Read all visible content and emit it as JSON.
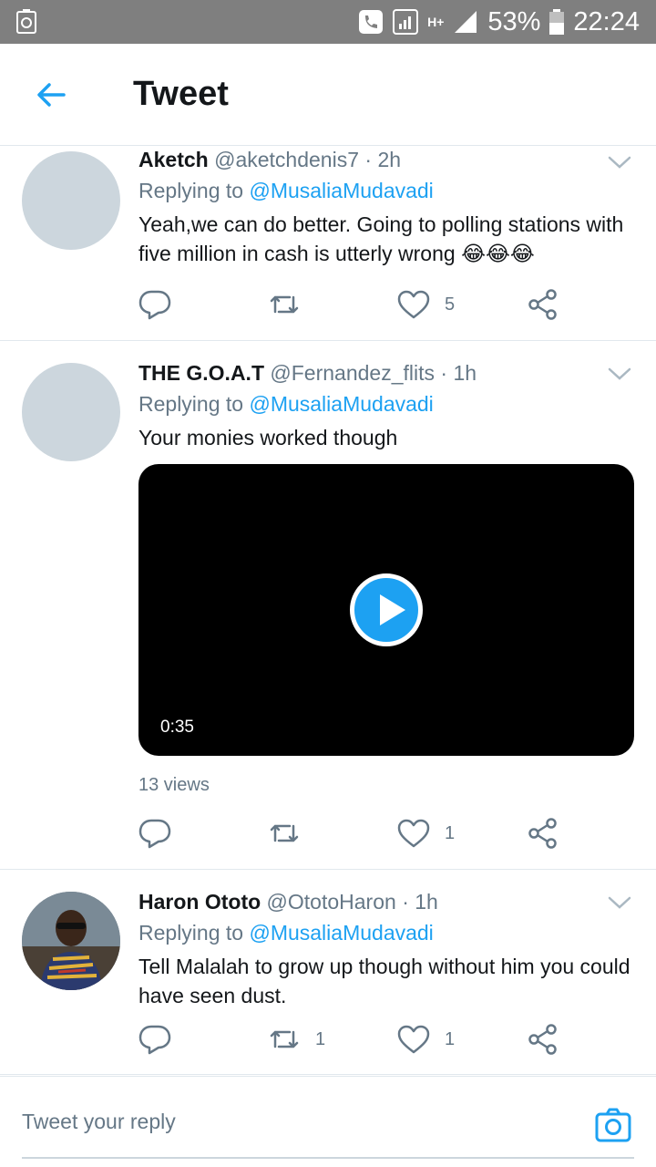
{
  "status_bar": {
    "battery": "53%",
    "time": "22:24",
    "network": "H+"
  },
  "header": {
    "title": "Tweet"
  },
  "tweets": [
    {
      "name": "Aketch",
      "handle": "@aketchdenis7",
      "separator": "·",
      "time": "2h",
      "replying_prefix": "Replying to",
      "replying_to": "@MusaliaMudavadi",
      "text": "Yeah,we can do better. Going to polling stations with five million in cash is utterly wrong 😂😂😂",
      "reply_count": "",
      "retweet_count": "",
      "like_count": "5"
    },
    {
      "name": "THE G.O.A.T",
      "handle": "@Fernandez_flits",
      "separator": "·",
      "time": "1h",
      "replying_prefix": "Replying to",
      "replying_to": "@MusaliaMudavadi",
      "text": "Your monies worked though",
      "video_duration": "0:35",
      "views": "13 views",
      "reply_count": "",
      "retweet_count": "",
      "like_count": "1"
    },
    {
      "name": "Haron Ototo",
      "handle": "@OtotoHaron",
      "separator": "·",
      "time": "1h",
      "replying_prefix": "Replying to",
      "replying_to": "@MusaliaMudavadi",
      "text": "Tell Malalah to grow up though without him you could have seen dust.",
      "reply_count": "",
      "retweet_count": "1",
      "like_count": "1"
    }
  ],
  "composer": {
    "placeholder": "Tweet your reply"
  },
  "colors": {
    "accent": "#1da1f2",
    "muted": "#657786",
    "text": "#14171a",
    "status_bar": "#7f7f7f"
  }
}
